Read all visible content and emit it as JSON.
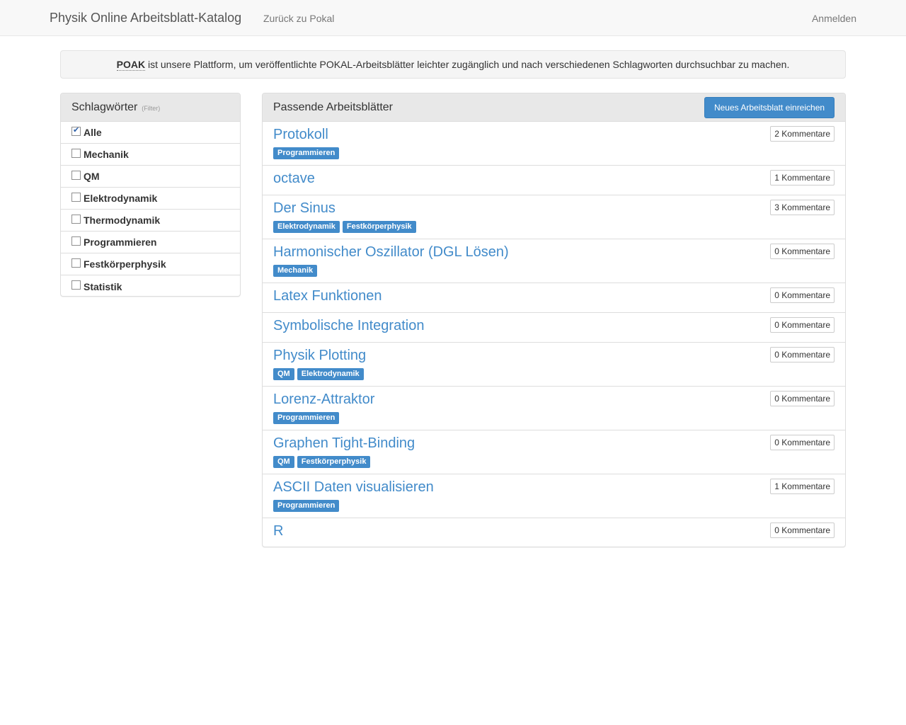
{
  "navbar": {
    "brand": "Physik Online Arbeitsblatt-Katalog",
    "back_link": "Zurück zu Pokal",
    "login_link": "Anmelden"
  },
  "info": {
    "abbr": "POAK",
    "text": " ist unsere Plattform, um veröffentlichte POKAL-Arbeitsblätter leichter zugänglich und nach verschiedenen Schlagworten durchsuchbar zu machen."
  },
  "sidebar": {
    "title": "Schlagwörter",
    "subtitle": "(Filter)",
    "items": [
      {
        "label": "Alle",
        "checked": true
      },
      {
        "label": "Mechanik",
        "checked": false
      },
      {
        "label": "QM",
        "checked": false
      },
      {
        "label": "Elektrodynamik",
        "checked": false
      },
      {
        "label": "Thermodynamik",
        "checked": false
      },
      {
        "label": "Programmieren",
        "checked": false
      },
      {
        "label": "Festkörperphysik",
        "checked": false
      },
      {
        "label": "Statistik",
        "checked": false
      }
    ]
  },
  "main": {
    "title": "Passende Arbeitsblätter",
    "new_button": "Neues Arbeitsblatt einreichen",
    "sheets": [
      {
        "title": "Protokoll",
        "comments": "2 Kommentare",
        "tags": [
          "Programmieren"
        ]
      },
      {
        "title": "octave",
        "comments": "1 Kommentare",
        "tags": []
      },
      {
        "title": "Der Sinus",
        "comments": "3 Kommentare",
        "tags": [
          "Elektrodynamik",
          "Festkörperphysik"
        ]
      },
      {
        "title": "Harmonischer Oszillator (DGL Lösen)",
        "comments": "0 Kommentare",
        "tags": [
          "Mechanik"
        ]
      },
      {
        "title": "Latex Funktionen",
        "comments": "0 Kommentare",
        "tags": []
      },
      {
        "title": "Symbolische Integration",
        "comments": "0 Kommentare",
        "tags": []
      },
      {
        "title": "Physik Plotting",
        "comments": "0 Kommentare",
        "tags": [
          "QM",
          "Elektrodynamik"
        ]
      },
      {
        "title": "Lorenz-Attraktor",
        "comments": "0 Kommentare",
        "tags": [
          "Programmieren"
        ]
      },
      {
        "title": "Graphen Tight-Binding",
        "comments": "0 Kommentare",
        "tags": [
          "QM",
          "Festkörperphysik"
        ]
      },
      {
        "title": "ASCII Daten visualisieren",
        "comments": "1 Kommentare",
        "tags": [
          "Programmieren"
        ]
      },
      {
        "title": "R",
        "comments": "0 Kommentare",
        "tags": []
      }
    ]
  }
}
